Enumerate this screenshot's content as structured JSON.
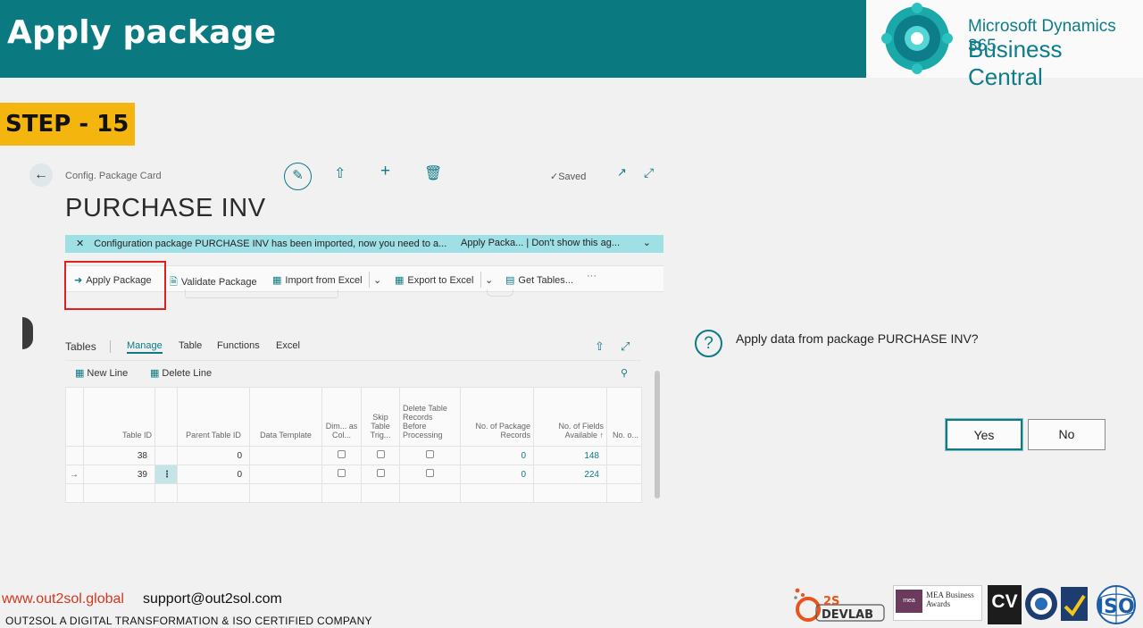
{
  "banner": {
    "title": "Apply package"
  },
  "brand": {
    "line1": "Microsoft Dynamics 365",
    "line2": "Business Central"
  },
  "step": {
    "label": "STEP - 15"
  },
  "bc": {
    "breadcrumb": "Config. Package Card",
    "saved": "Saved",
    "title": "PURCHASE INV",
    "notification": {
      "message": "Configuration package PURCHASE INV has been imported, now you need to a...",
      "action": "Apply Packa...",
      "dismiss": "Don't show this ag..."
    },
    "actions": {
      "apply_package": "Apply Package",
      "validate_package": "Validate Package",
      "import_excel": "Import from Excel",
      "export_excel": "Export to Excel",
      "get_tables": "Get Tables..."
    },
    "tables_part": {
      "title": "Tables",
      "tabs": [
        "Manage",
        "Table",
        "Functions",
        "Excel"
      ],
      "new_line": "New Line",
      "delete_line": "Delete Line",
      "columns": [
        "Table ID",
        "Parent Table ID",
        "Data Template",
        "Dim... as Col...",
        "Skip Table Trig...",
        "Delete Table Records Before Processing",
        "No. of Package Records",
        "No. of Fields Available ↑",
        "No. o..."
      ],
      "rows": [
        {
          "table_id": "38",
          "parent_table_id": "0",
          "package_records": "0",
          "fields_available": "148"
        },
        {
          "table_id": "39",
          "parent_table_id": "0",
          "package_records": "0",
          "fields_available": "224"
        }
      ]
    }
  },
  "dialog": {
    "question": "Apply data from package PURCHASE INV?",
    "yes": "Yes",
    "no": "No"
  },
  "footer": {
    "website": "www.out2sol.global",
    "email": "support@out2sol.com",
    "tagline": "OUT2SOL A DIGITAL TRANSFORMATION & ISO CERTIFIED COMPANY",
    "logos": {
      "devlab": "2S DEVLAB",
      "mea": "MEA Business Awards",
      "cv": "CV",
      "iso": "ISO"
    }
  },
  "colors": {
    "banner": "#0b7a80",
    "accent": "#0d7a86",
    "step": "#f5b50f",
    "highlight": "#e02020",
    "notification": "#9fe0e6"
  }
}
